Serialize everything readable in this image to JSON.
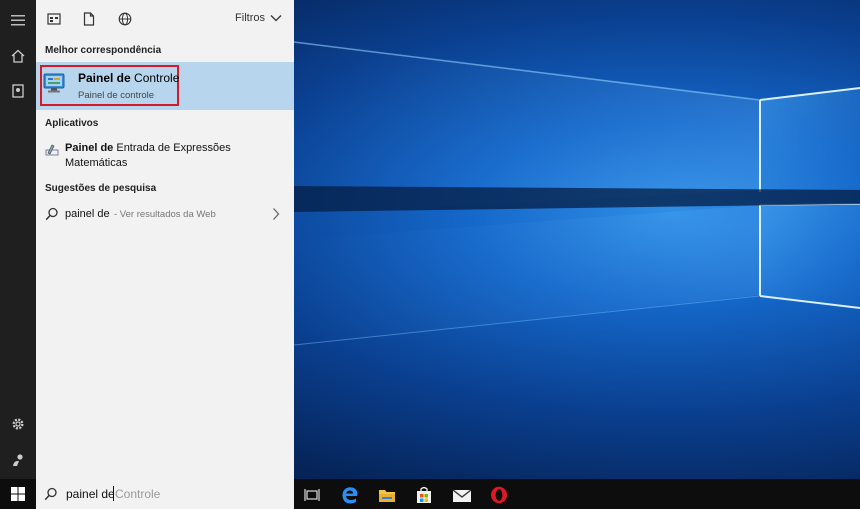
{
  "start_panel": {
    "filters_label": "Filtros",
    "best_match": {
      "section_label": "Melhor correspondência",
      "title_bold": "Painel de",
      "title_rest": " Controle",
      "subtitle": "Painel de controle",
      "icon": "control-panel-icon"
    },
    "apps": {
      "section_label": "Aplicativos",
      "items": [
        {
          "title_bold": "Painel de",
          "title_rest": " Entrada de Expressões Matemáticas",
          "icon": "math-input-panel-icon"
        }
      ]
    },
    "suggestions": {
      "section_label": "Sugestões de pesquisa",
      "items": [
        {
          "query": "painel de",
          "hint": " - Ver resultados da Web"
        }
      ]
    }
  },
  "taskbar": {
    "search_typed": "painel de",
    "search_autocomplete": "Controle",
    "apps": [
      "task-view-icon",
      "edge-icon",
      "file-explorer-icon",
      "store-icon",
      "mail-icon",
      "opera-icon"
    ]
  },
  "colors": {
    "selection": "#b7d6ee",
    "highlight_outline": "#d61a2b",
    "panel": "#f2f2f2",
    "rail": "#1f1f1f"
  }
}
